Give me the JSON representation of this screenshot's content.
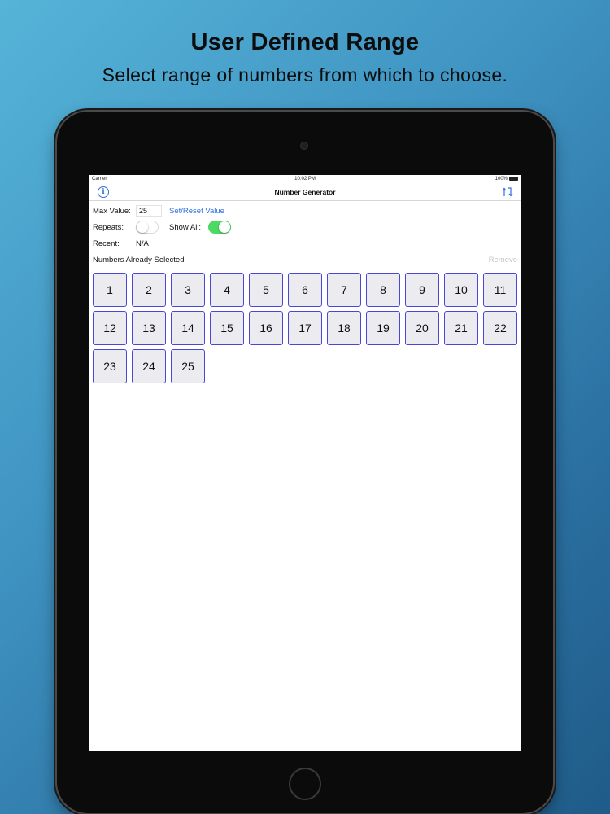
{
  "promo": {
    "title": "User Defined Range",
    "subtitle": "Select range of numbers from which to choose."
  },
  "status_bar": {
    "carrier": "Carrier",
    "time": "10:02 PM",
    "battery": "100%"
  },
  "nav": {
    "title": "Number Generator",
    "left_icon": "info-icon",
    "right_icon": "refresh-arrows-icon"
  },
  "form": {
    "max_value_label": "Max Value:",
    "max_value": "25",
    "set_reset_label": "Set/Reset Value",
    "repeats_label": "Repeats:",
    "repeats_on": false,
    "show_all_label": "Show All:",
    "show_all_on": true,
    "recent_label": "Recent:",
    "recent_value": "N/A",
    "selected_header": "Numbers Already Selected",
    "remove_label": "Remove"
  },
  "numbers": [
    "1",
    "2",
    "3",
    "4",
    "5",
    "6",
    "7",
    "8",
    "9",
    "10",
    "11",
    "12",
    "13",
    "14",
    "15",
    "16",
    "17",
    "18",
    "19",
    "20",
    "21",
    "22",
    "23",
    "24",
    "25"
  ],
  "colors": {
    "accent": "#2f6fde",
    "cell_border": "#4b47d6",
    "cell_fill": "#ececf0",
    "toggle_on": "#4cd964"
  }
}
